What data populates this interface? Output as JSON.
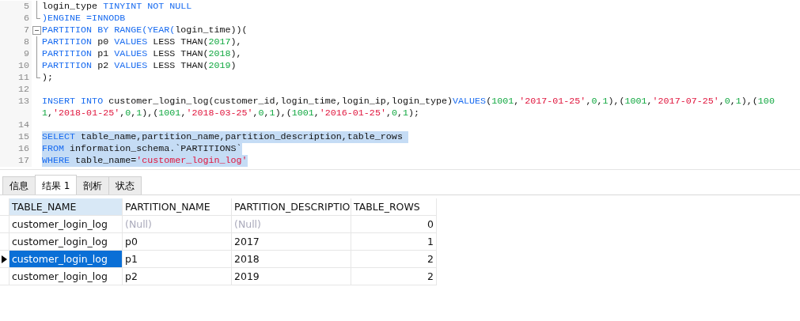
{
  "editor": {
    "lines": [
      {
        "number": "5",
        "kind": "guide",
        "selected": false,
        "tokens": [
          {
            "kind": "plain",
            "text": "login_type "
          },
          {
            "kind": "keyword",
            "text": "TINYINT NOT NULL"
          }
        ]
      },
      {
        "number": "6",
        "kind": "end",
        "selected": false,
        "tokens": [
          {
            "kind": "keyword",
            "text": ")ENGINE =INNODB"
          }
        ]
      },
      {
        "number": "7",
        "kind": "start",
        "selected": false,
        "tokens": [
          {
            "kind": "keyword",
            "text": "PARTITION BY RANGE(YEAR("
          },
          {
            "kind": "plain",
            "text": "login_time))("
          }
        ]
      },
      {
        "number": "8",
        "kind": "guide",
        "selected": false,
        "tokens": [
          {
            "kind": "keyword",
            "text": "PARTITION "
          },
          {
            "kind": "plain",
            "text": "p0 "
          },
          {
            "kind": "keyword",
            "text": "VALUES "
          },
          {
            "kind": "plain",
            "text": "LESS THAN("
          },
          {
            "kind": "number",
            "text": "2017"
          },
          {
            "kind": "plain",
            "text": "),"
          }
        ]
      },
      {
        "number": "9",
        "kind": "guide",
        "selected": false,
        "tokens": [
          {
            "kind": "keyword",
            "text": "PARTITION "
          },
          {
            "kind": "plain",
            "text": "p1 "
          },
          {
            "kind": "keyword",
            "text": "VALUES "
          },
          {
            "kind": "plain",
            "text": "LESS THAN("
          },
          {
            "kind": "number",
            "text": "2018"
          },
          {
            "kind": "plain",
            "text": "),"
          }
        ]
      },
      {
        "number": "10",
        "kind": "guide",
        "selected": false,
        "tokens": [
          {
            "kind": "keyword",
            "text": "PARTITION "
          },
          {
            "kind": "plain",
            "text": "p2 "
          },
          {
            "kind": "keyword",
            "text": "VALUES "
          },
          {
            "kind": "plain",
            "text": "LESS THAN("
          },
          {
            "kind": "number",
            "text": "2019"
          },
          {
            "kind": "plain",
            "text": ")"
          }
        ]
      },
      {
        "number": "11",
        "kind": "end",
        "selected": false,
        "tokens": [
          {
            "kind": "plain",
            "text": ");"
          }
        ]
      },
      {
        "number": "12",
        "kind": "plain",
        "selected": false
      },
      {
        "number": "13",
        "kind": "plain",
        "selected": false,
        "tokens": [
          {
            "kind": "keyword",
            "text": "INSERT INTO "
          },
          {
            "kind": "plain",
            "text": "customer_login_log(customer_id,login_time,login_ip,login_type)"
          },
          {
            "kind": "keyword",
            "text": "VALUES"
          },
          {
            "kind": "plain",
            "text": "("
          },
          {
            "kind": "number",
            "text": "1001"
          },
          {
            "kind": "plain",
            "text": ","
          },
          {
            "kind": "string",
            "text": "'2017-01-25'"
          },
          {
            "kind": "plain",
            "text": ","
          },
          {
            "kind": "number",
            "text": "0"
          },
          {
            "kind": "plain",
            "text": ","
          },
          {
            "kind": "number",
            "text": "1"
          },
          {
            "kind": "plain",
            "text": "),("
          },
          {
            "kind": "number",
            "text": "1001"
          },
          {
            "kind": "plain",
            "text": ","
          },
          {
            "kind": "string",
            "text": "'2017-07-25'"
          },
          {
            "kind": "plain",
            "text": ","
          },
          {
            "kind": "number",
            "text": "0"
          },
          {
            "kind": "plain",
            "text": ","
          },
          {
            "kind": "number",
            "text": "1"
          },
          {
            "kind": "plain",
            "text": "),("
          },
          {
            "kind": "number",
            "text": "1001"
          },
          {
            "kind": "plain",
            "text": ","
          },
          {
            "kind": "string",
            "text": "'2018-01-25'"
          },
          {
            "kind": "plain",
            "text": ","
          },
          {
            "kind": "number",
            "text": "0"
          },
          {
            "kind": "plain",
            "text": ","
          },
          {
            "kind": "number",
            "text": "1"
          },
          {
            "kind": "plain",
            "text": "),("
          },
          {
            "kind": "number",
            "text": "1001"
          },
          {
            "kind": "plain",
            "text": ","
          },
          {
            "kind": "string",
            "text": "'2018-03-25'"
          },
          {
            "kind": "plain",
            "text": ","
          },
          {
            "kind": "number",
            "text": "0"
          },
          {
            "kind": "plain",
            "text": ","
          },
          {
            "kind": "number",
            "text": "1"
          },
          {
            "kind": "plain",
            "text": "),("
          },
          {
            "kind": "number",
            "text": "1001"
          },
          {
            "kind": "plain",
            "text": ","
          },
          {
            "kind": "string",
            "text": "'2016-01-25'"
          },
          {
            "kind": "plain",
            "text": ","
          },
          {
            "kind": "number",
            "text": "0"
          },
          {
            "kind": "plain",
            "text": ","
          },
          {
            "kind": "number",
            "text": "1"
          },
          {
            "kind": "plain",
            "text": ");"
          }
        ]
      },
      {
        "number": "14",
        "kind": "plain",
        "selected": false
      },
      {
        "number": "15",
        "kind": "plain",
        "selected": true,
        "tokens": [
          {
            "kind": "keyword",
            "text": "SELECT "
          },
          {
            "kind": "plain",
            "text": "table_name,partition_name,partition_description,table_rows "
          }
        ]
      },
      {
        "number": "16",
        "kind": "plain",
        "selected": true,
        "tokens": [
          {
            "kind": "keyword",
            "text": "FROM "
          },
          {
            "kind": "plain",
            "text": "information_schema.`PARTITIONS`"
          }
        ]
      },
      {
        "number": "17",
        "kind": "plain",
        "selected": true,
        "tokens": [
          {
            "kind": "keyword",
            "text": "WHERE "
          },
          {
            "kind": "plain",
            "text": "table_name="
          },
          {
            "kind": "string",
            "text": "'customer_login_log'"
          }
        ]
      }
    ]
  },
  "tabs": [
    {
      "label": "信息",
      "selected": false
    },
    {
      "label": "结果 1",
      "selected": true
    },
    {
      "label": "剖析",
      "selected": false
    },
    {
      "label": "状态",
      "selected": false
    }
  ],
  "grid": {
    "columns": [
      {
        "label": "TABLE_NAME",
        "selected": true,
        "kind": "text"
      },
      {
        "label": "PARTITION_NAME",
        "selected": false,
        "kind": "text"
      },
      {
        "label": "PARTITION_DESCRIPTIO",
        "selected": false,
        "kind": "text"
      },
      {
        "label": "TABLE_ROWS",
        "selected": false,
        "kind": "number"
      }
    ],
    "rows": [
      {
        "selected": false,
        "cells": [
          {
            "text": "customer_login_log",
            "null": false
          },
          {
            "text": "(Null)",
            "null": true
          },
          {
            "text": "(Null)",
            "null": true
          },
          {
            "text": "0",
            "null": false
          }
        ]
      },
      {
        "selected": false,
        "cells": [
          {
            "text": "customer_login_log",
            "null": false
          },
          {
            "text": "p0",
            "null": false
          },
          {
            "text": "2017",
            "null": false
          },
          {
            "text": "1",
            "null": false
          }
        ]
      },
      {
        "selected": true,
        "cells": [
          {
            "text": "customer_login_log",
            "null": false
          },
          {
            "text": "p1",
            "null": false
          },
          {
            "text": "2018",
            "null": false
          },
          {
            "text": "2",
            "null": false
          }
        ]
      },
      {
        "selected": false,
        "cells": [
          {
            "text": "customer_login_log",
            "null": false
          },
          {
            "text": "p2",
            "null": false
          },
          {
            "text": "2019",
            "null": false
          },
          {
            "text": "2",
            "null": false
          }
        ]
      }
    ]
  }
}
